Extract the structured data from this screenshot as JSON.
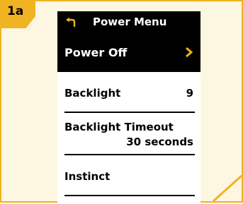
{
  "step_label": "1a",
  "colors": {
    "accent": "#F0B321",
    "page_background": "#FDF7E2",
    "screen_background": "#FFFFFF",
    "screen_bar": "#000000"
  },
  "header": {
    "back_icon": "back-arrow-icon",
    "title": "Power Menu"
  },
  "selected_item": {
    "label": "Power Off",
    "icon": "chevron-right-icon"
  },
  "menu_items": [
    {
      "label": "Backlight",
      "value": "9"
    },
    {
      "label": "Backlight Timeout",
      "value": "30 seconds"
    },
    {
      "label": "Instinct",
      "value": ""
    }
  ]
}
